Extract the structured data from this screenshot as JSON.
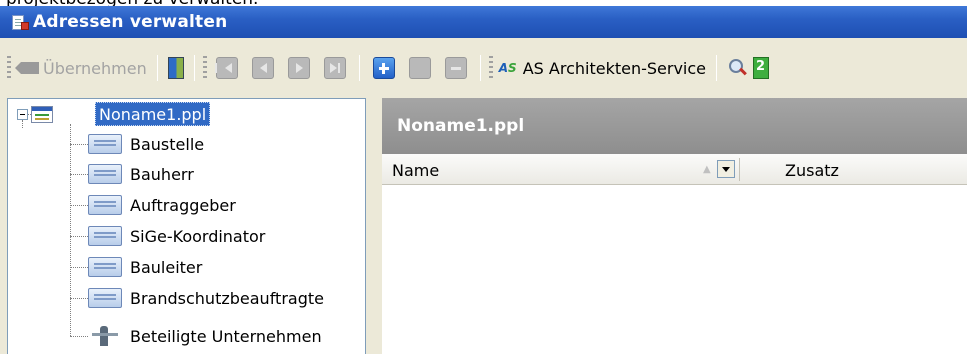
{
  "page_above": {
    "text": "projektbezogen zu verwalten."
  },
  "window": {
    "title": "Adressen verwalten"
  },
  "toolbar": {
    "accept_label": "Übernehmen",
    "service_label": "AS Architekten-Service",
    "icons": [
      "accept-icon",
      "door-icon",
      "first-icon",
      "prev-icon",
      "next-icon",
      "last-icon",
      "add-icon",
      "edit-icon",
      "remove-icon",
      "as-logo-icon",
      "search-icon",
      "green-doc-icon"
    ]
  },
  "tree": {
    "root": "Noname1.ppl",
    "items": [
      {
        "label": "Baustelle",
        "icon": "form-icon"
      },
      {
        "label": "Bauherr",
        "icon": "form-icon"
      },
      {
        "label": "Auftraggeber",
        "icon": "form-icon"
      },
      {
        "label": "SiGe-Koordinator",
        "icon": "form-icon"
      },
      {
        "label": "Bauleiter",
        "icon": "form-icon"
      },
      {
        "label": "Brandschutzbeauftragte",
        "icon": "form-icon"
      },
      {
        "label": "Beteiligte Unternehmen",
        "icon": "people-icon"
      }
    ]
  },
  "main": {
    "title": "Noname1.ppl",
    "columns": [
      "Name",
      "Zusatz"
    ]
  },
  "colors": {
    "titlebar": "#2a5fc4",
    "selection": "#316ac5",
    "panel_header": "#9a9a9a",
    "toolbar_bg": "#ece9d8"
  }
}
